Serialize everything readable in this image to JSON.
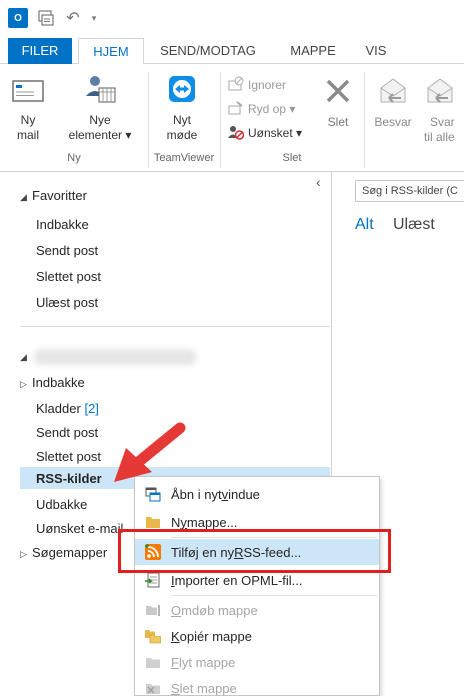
{
  "quick_access": {
    "logo_text": "O"
  },
  "tabs": [
    "FILER",
    "HJEM",
    "SEND/MODTAG",
    "MAPPE",
    "VIS"
  ],
  "ribbon": {
    "new_mail": [
      "Ny",
      "mail"
    ],
    "new_items": [
      "Nye",
      "elementer ▾"
    ],
    "new_items_group": "Ny",
    "new_meeting": [
      "Nyt",
      "møde"
    ],
    "teamviewer_group": "TeamViewer",
    "ignore": "Ignorer",
    "cleanup": "Ryd op ▾",
    "junk": "Uønsket ▾",
    "delete": "Slet",
    "delete_group": "Slet",
    "reply": "Besvar",
    "reply_all": [
      "Svar",
      "til alle"
    ]
  },
  "folder_pane": {
    "collapse_glyph": "‹",
    "favorites_header": "Favoritter",
    "favorites": [
      "Indbakke",
      "Sendt post",
      "Slettet post",
      "Ulæst post"
    ],
    "inbox": "Indbakke",
    "drafts": "Kladder",
    "drafts_count": "[2]",
    "sent": "Sendt post",
    "deleted": "Slettet post",
    "rss": "RSS-kilder",
    "outbox": "Udbakke",
    "junk_email": "Uønsket e-mail",
    "search_folders": "Søgemapper"
  },
  "right_pane": {
    "search_placeholder": "Søg i RSS-kilder (C",
    "filter_all": "Alt",
    "filter_unread": "Ulæst"
  },
  "context_menu": {
    "items": [
      {
        "pre": "Åbn i nyt ",
        "u": "v",
        "post": "indue",
        "enabled": true
      },
      {
        "pre": "N",
        "u": "y",
        "post": " mappe...",
        "enabled": true
      },
      {
        "pre": "Tilføj en ny ",
        "u": "R",
        "post": "SS-feed...",
        "enabled": true
      },
      {
        "pre": "",
        "u": "I",
        "post": "mporter en OPML-fil...",
        "enabled": true
      },
      {
        "pre": "",
        "u": "O",
        "post": "mdøb mappe",
        "enabled": false
      },
      {
        "pre": "",
        "u": "K",
        "post": "opiér mappe",
        "enabled": true
      },
      {
        "pre": "",
        "u": "F",
        "post": "lyt mappe",
        "enabled": false
      },
      {
        "pre": "",
        "u": "S",
        "post": "let mappe",
        "enabled": false
      }
    ]
  },
  "colors": {
    "accent": "#0072c6",
    "highlight": "#e02020",
    "selection": "#cde6f7",
    "rss": "#f57c00"
  },
  "icons": [
    "outlook-logo-icon",
    "send-receive-icon",
    "undo-icon",
    "new-mail-icon",
    "new-items-icon",
    "teamviewer-icon",
    "ignore-icon",
    "cleanup-icon",
    "junk-icon",
    "delete-icon",
    "reply-icon",
    "reply-all-icon",
    "new-window-icon",
    "folder-icon",
    "rss-feed-icon",
    "import-icon",
    "rename-icon",
    "copy-folder-icon",
    "move-folder-icon",
    "delete-folder-icon",
    "red-arrow-icon"
  ]
}
